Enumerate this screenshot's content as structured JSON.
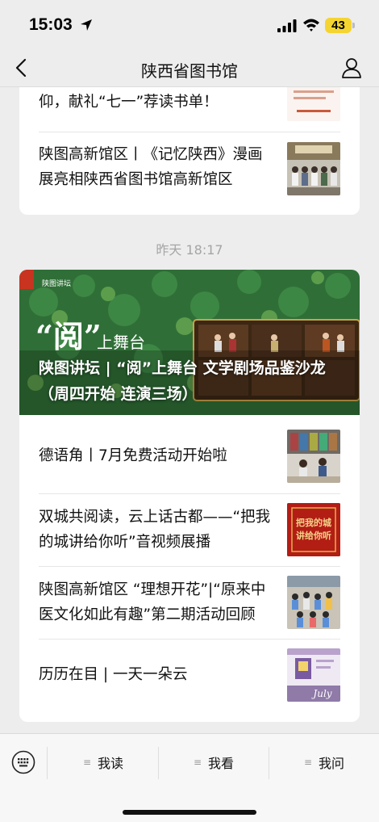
{
  "status_bar": {
    "time": "15:03",
    "battery": "43"
  },
  "nav": {
    "title": "陕西省图书馆"
  },
  "card1": {
    "items": [
      {
        "title": "陕图高新馆区｜阅读坚定，践行信仰，献礼“七一”荐读书单！"
      },
      {
        "title": "陕图高新馆区丨《记忆陕西》漫画展亮相陕西省图书馆高新馆区"
      }
    ]
  },
  "timestamp": "昨天 18:17",
  "card2": {
    "hero": {
      "title": "陕图讲坛 | “阅”上舞台 文学剧场品鉴沙龙（周四开始 连演三场）",
      "brand": "陕图讲坛",
      "tag": "“阅”",
      "tag_sub": "上舞台"
    },
    "items": [
      {
        "title": "德语角丨7月免费活动开始啦"
      },
      {
        "title": "双城共阅读，云上话古都——“把我的城讲给你听”音视频展播",
        "thumb_text": "把我的城\n讲给你听"
      },
      {
        "title": "陕图高新馆区 “理想开花”|“原来中医文化如此有趣”第二期活动回顾"
      },
      {
        "title": "历历在目 | 一天一朵云",
        "thumb_text": "July"
      }
    ]
  },
  "tabbar": {
    "tabs": [
      {
        "label": "我读"
      },
      {
        "label": "我看"
      },
      {
        "label": "我问"
      }
    ]
  },
  "colors": {
    "background": "#ededed",
    "card": "#ffffff",
    "battery": "#f5d431",
    "timestamp": "#a5a5a5"
  }
}
